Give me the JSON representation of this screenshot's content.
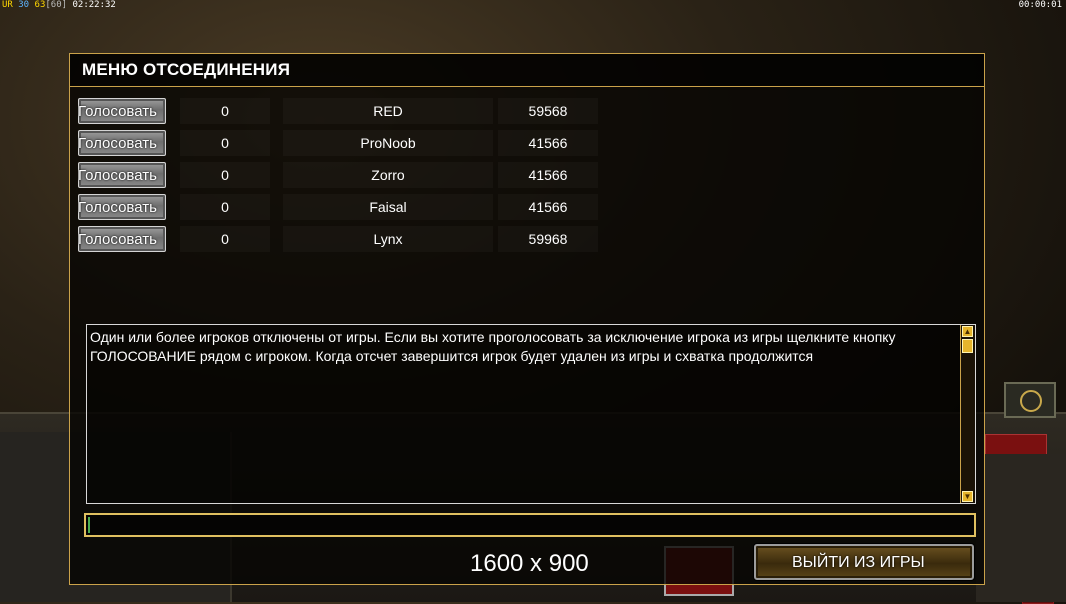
{
  "hud": {
    "ur_label": "UR",
    "fps": "30",
    "fps2": "63",
    "fps_limit": "[60]",
    "clock": "02:22:32",
    "timer": "00:00:01"
  },
  "dialog": {
    "title": "МЕНЮ ОТСОЕДИНЕНИЯ",
    "players": [
      {
        "vote_label": "Голосовать",
        "votes": "0",
        "name": "RED",
        "ping": "59568"
      },
      {
        "vote_label": "Голосовать",
        "votes": "0",
        "name": "ProNoob",
        "ping": "41566"
      },
      {
        "vote_label": "Голосовать",
        "votes": "0",
        "name": "Zorro",
        "ping": "41566"
      },
      {
        "vote_label": "Голосовать",
        "votes": "0",
        "name": "Faisal",
        "ping": "41566"
      },
      {
        "vote_label": "Голосовать",
        "votes": "0",
        "name": "Lynx",
        "ping": "59968"
      }
    ],
    "message": "Один или более игроков отключены от игры. Если вы хотите проголосовать за исключение игрока из игры щелкните  кнопку ГОЛОСОВАНИЕ рядом с игроком. Когда отсчет завершится игрок будет удален из игры и схватка продолжится",
    "chat_value": "",
    "resolution": "1600 x 900",
    "quit_label": "ВЫЙТИ ИЗ ИГРЫ"
  },
  "colors": {
    "border_gold": "#caa24a",
    "scroll_gold": "#e6b52c",
    "input_border": "#e0c060"
  }
}
